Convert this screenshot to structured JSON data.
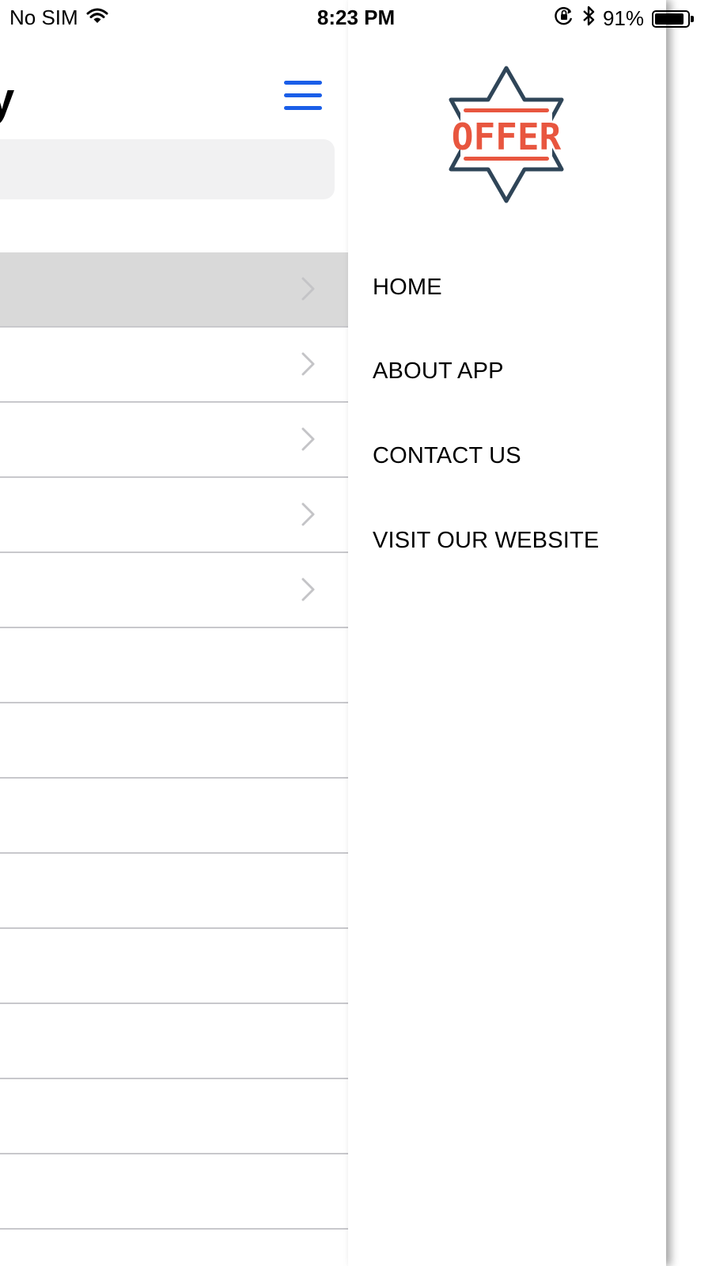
{
  "status_bar": {
    "carrier": "No SIM",
    "time": "8:23 PM",
    "battery_percent": "91%",
    "battery_level": 0.91,
    "icons": [
      "wifi-icon",
      "orientation-lock-icon",
      "bluetooth-icon",
      "battery-icon"
    ]
  },
  "main": {
    "title_fragment": "y",
    "menu_icon": "hamburger-icon",
    "accent_color": "#1a5ee8",
    "rows_with_chevron": 5,
    "total_rows": 13
  },
  "drawer": {
    "logo": {
      "text": "OFFER",
      "star_color": "#2f4558",
      "text_color": "#e8563f"
    },
    "items": [
      {
        "label": "HOME"
      },
      {
        "label": "ABOUT APP"
      },
      {
        "label": "CONTACT US"
      },
      {
        "label": "VISIT OUR WEBSITE"
      }
    ]
  }
}
